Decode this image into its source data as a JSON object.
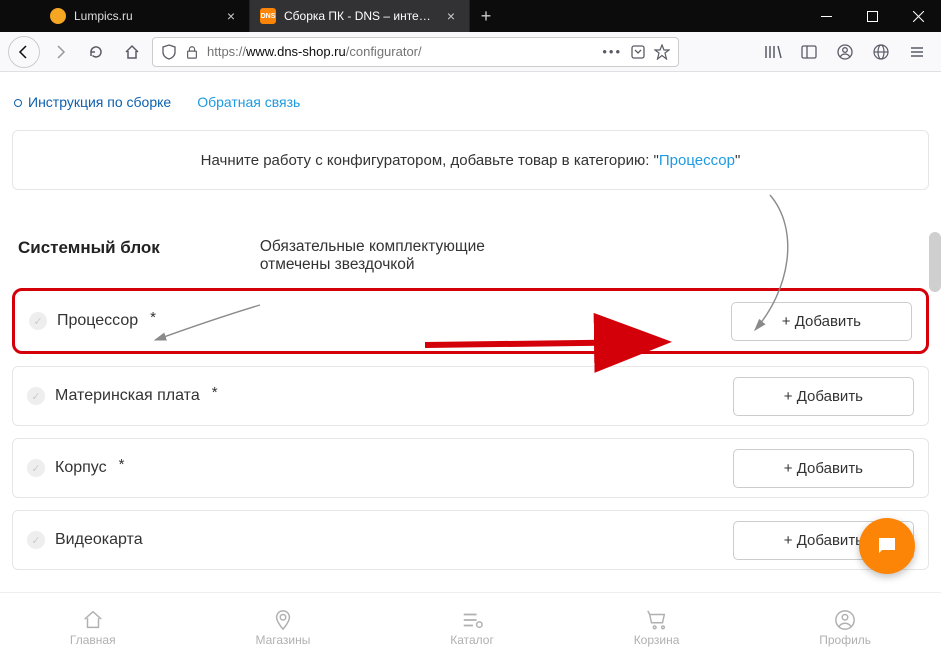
{
  "browser": {
    "tabs": [
      {
        "title": "Lumpics.ru",
        "active": false,
        "favicon_color": "#f5a623"
      },
      {
        "title": "Сборка ПК - DNS – интернет м",
        "active": true,
        "favicon_label": "DNS",
        "favicon_color": "#fc8507"
      }
    ],
    "url_prefix": "https://",
    "url_host": "www.dns-shop.ru",
    "url_path": "/configurator/"
  },
  "page": {
    "links": {
      "instructions": "Инструкция по сборке",
      "feedback": "Обратная связь"
    },
    "banner_prefix": "Начните работу с конфигуратором, добавьте товар в категорию: \"",
    "banner_link": "Процессор",
    "banner_suffix": "\"",
    "section_title": "Системный блок",
    "section_sub_line1": "Обязательные комплектующие",
    "section_sub_line2": "отмечены звездочкой",
    "rows": [
      {
        "label": "Процессор",
        "required": true,
        "add": "+ Добавить",
        "highlighted": true
      },
      {
        "label": "Материнская плата",
        "required": true,
        "add": "+ Добавить",
        "highlighted": false
      },
      {
        "label": "Корпус",
        "required": true,
        "add": "+ Добавить",
        "highlighted": false
      },
      {
        "label": "Видеокарта",
        "required": false,
        "add": "+ Добавить",
        "highlighted": false
      }
    ]
  },
  "bottom_nav": {
    "home": "Главная",
    "stores": "Магазины",
    "catalog": "Каталог",
    "cart": "Корзина",
    "profile": "Профиль"
  }
}
